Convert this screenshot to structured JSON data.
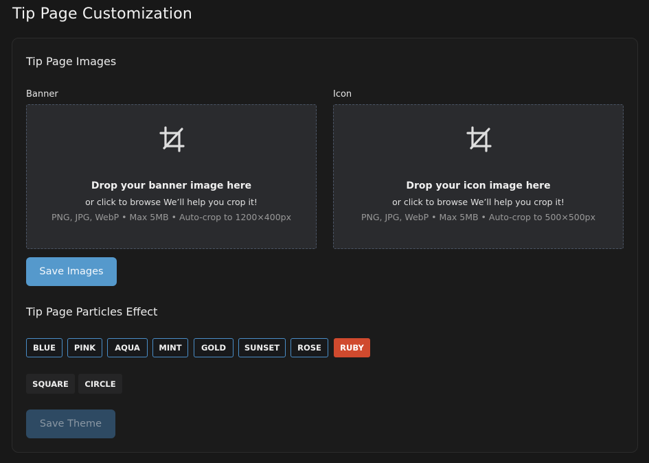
{
  "page": {
    "title": "Tip Page Customization"
  },
  "images_section": {
    "title": "Tip Page Images",
    "banner": {
      "label": "Banner",
      "drop_title": "Drop your banner image here",
      "drop_sub": "or click to browse We’ll help you crop it!",
      "drop_hint": "PNG, JPG, WebP • Max 5MB • Auto-crop to 1200×400px",
      "icon": "crop-icon"
    },
    "icon": {
      "label": "Icon",
      "drop_title": "Drop your icon image here",
      "drop_sub": "or click to browse We’ll help you crop it!",
      "drop_hint": "PNG, JPG, WebP • Max 5MB • Auto-crop to 500×500px",
      "icon": "crop-icon"
    },
    "save_label": "Save Images"
  },
  "particles_section": {
    "title": "Tip Page Particles Effect",
    "colors": [
      "BLUE",
      "PINK",
      "AQUA",
      "MINT",
      "GOLD",
      "SUNSET",
      "ROSE",
      "RUBY"
    ],
    "selected_color": "RUBY",
    "shapes": [
      "SQUARE",
      "CIRCLE"
    ],
    "save_label": "Save Theme"
  },
  "theme": {
    "accent": "#5599cc",
    "selected_chip": "#d04a2e",
    "chip_border": "#4a8ec8"
  }
}
